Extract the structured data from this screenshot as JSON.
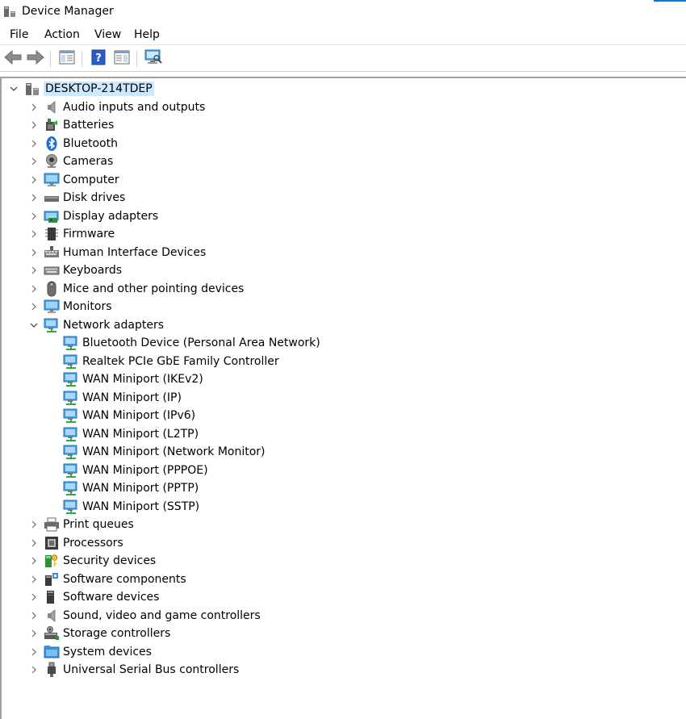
{
  "window": {
    "title": "Device Manager",
    "accent_color": "#0078d7"
  },
  "menu": [
    "File",
    "Action",
    "View",
    "Help"
  ],
  "toolbar": [
    {
      "icon": "back-arrow-icon"
    },
    {
      "icon": "forward-arrow-icon"
    },
    {
      "icon": "show-hide-console-tree-icon"
    },
    {
      "icon": "help-icon"
    },
    {
      "icon": "show-hide-action-pane-icon"
    },
    {
      "icon": "scan-hardware-changes-icon"
    }
  ],
  "tree": {
    "root": {
      "label": "DESKTOP-214TDEP",
      "icon": "computer-tower-icon",
      "expanded": true,
      "selected_color": "#cce8ff"
    },
    "categories": [
      {
        "label": "Audio inputs and outputs",
        "icon": "speaker-icon"
      },
      {
        "label": "Batteries",
        "icon": "battery-icon"
      },
      {
        "label": "Bluetooth",
        "icon": "bluetooth-icon"
      },
      {
        "label": "Cameras",
        "icon": "camera-icon"
      },
      {
        "label": "Computer",
        "icon": "monitor-computer-icon"
      },
      {
        "label": "Disk drives",
        "icon": "disk-drive-icon"
      },
      {
        "label": "Display adapters",
        "icon": "display-adapter-icon"
      },
      {
        "label": "Firmware",
        "icon": "firmware-chip-icon"
      },
      {
        "label": "Human Interface Devices",
        "icon": "hid-icon"
      },
      {
        "label": "Keyboards",
        "icon": "keyboard-icon"
      },
      {
        "label": "Mice and other pointing devices",
        "icon": "mouse-icon"
      },
      {
        "label": "Monitors",
        "icon": "monitor-icon"
      },
      {
        "label": "Network adapters",
        "icon": "network-adapter-icon",
        "expanded": true,
        "children": [
          "Bluetooth Device (Personal Area Network)",
          "Realtek PCIe GbE Family Controller",
          "WAN Miniport (IKEv2)",
          "WAN Miniport (IP)",
          "WAN Miniport (IPv6)",
          "WAN Miniport (L2TP)",
          "WAN Miniport (Network Monitor)",
          "WAN Miniport (PPPOE)",
          "WAN Miniport (PPTP)",
          "WAN Miniport (SSTP)"
        ]
      },
      {
        "label": "Print queues",
        "icon": "printer-icon"
      },
      {
        "label": "Processors",
        "icon": "processor-icon"
      },
      {
        "label": "Security devices",
        "icon": "security-key-icon"
      },
      {
        "label": "Software components",
        "icon": "software-component-icon"
      },
      {
        "label": "Software devices",
        "icon": "software-device-icon"
      },
      {
        "label": "Sound, video and game controllers",
        "icon": "sound-icon"
      },
      {
        "label": "Storage controllers",
        "icon": "storage-controller-icon"
      },
      {
        "label": "System devices",
        "icon": "system-folder-icon"
      },
      {
        "label": "Universal Serial Bus controllers",
        "icon": "usb-icon"
      }
    ]
  }
}
